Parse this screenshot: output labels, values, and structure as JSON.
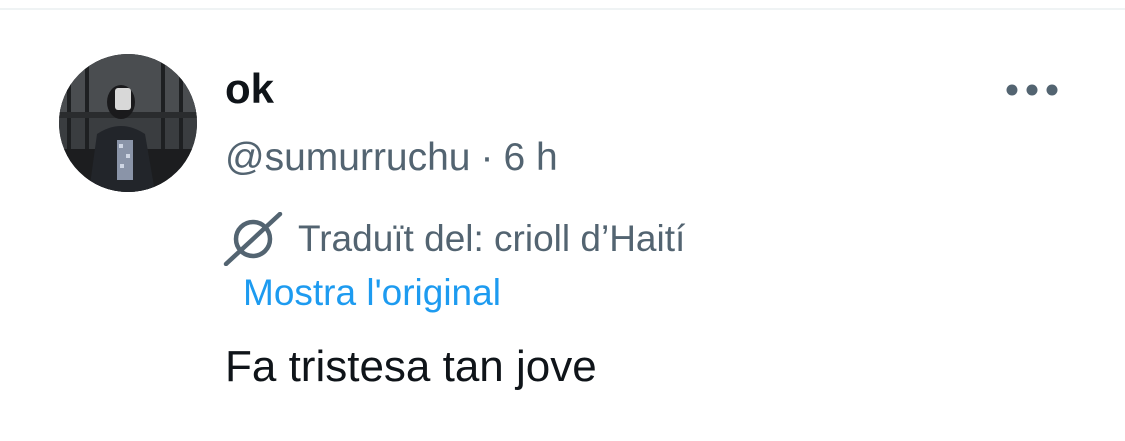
{
  "tweet": {
    "display_name": "ok",
    "handle": "@sumurruchu",
    "separator": "·",
    "time": "6 h",
    "translation_label": "Traduït del: crioll d’Haití",
    "show_original_label": "Mostra l'original",
    "text": "Fa tristesa tan jove"
  },
  "icons": {
    "more": "more-horizontal-icon",
    "translate": "translate-icon"
  },
  "colors": {
    "primary_text": "#0f1419",
    "secondary_text": "#536471",
    "link": "#1d9bf0",
    "divider": "#eff3f4"
  }
}
